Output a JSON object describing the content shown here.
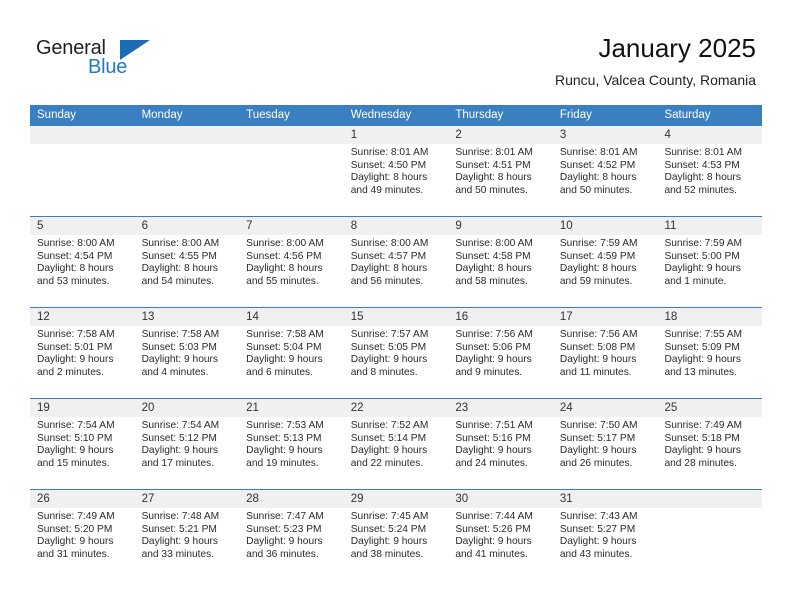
{
  "brand": {
    "name_top": "General",
    "name_bottom": "Blue",
    "accent_color": "#2079c7",
    "triangle_color": "#1b6cb5",
    "triangle_icon": "triangle-icon"
  },
  "header": {
    "title": "January 2025",
    "subtitle": "Runcu, Valcea County, Romania"
  },
  "calendar": {
    "header_bg": "#3a7fc1",
    "band_bg": "#f0f0f0",
    "weekdays": [
      "Sunday",
      "Monday",
      "Tuesday",
      "Wednesday",
      "Thursday",
      "Friday",
      "Saturday"
    ],
    "weeks": [
      [
        {
          "day": "",
          "lines": [
            "",
            "",
            "",
            ""
          ]
        },
        {
          "day": "",
          "lines": [
            "",
            "",
            "",
            ""
          ]
        },
        {
          "day": "",
          "lines": [
            "",
            "",
            "",
            ""
          ]
        },
        {
          "day": "1",
          "lines": [
            "Sunrise: 8:01 AM",
            "Sunset: 4:50 PM",
            "Daylight: 8 hours",
            "and 49 minutes."
          ]
        },
        {
          "day": "2",
          "lines": [
            "Sunrise: 8:01 AM",
            "Sunset: 4:51 PM",
            "Daylight: 8 hours",
            "and 50 minutes."
          ]
        },
        {
          "day": "3",
          "lines": [
            "Sunrise: 8:01 AM",
            "Sunset: 4:52 PM",
            "Daylight: 8 hours",
            "and 50 minutes."
          ]
        },
        {
          "day": "4",
          "lines": [
            "Sunrise: 8:01 AM",
            "Sunset: 4:53 PM",
            "Daylight: 8 hours",
            "and 52 minutes."
          ]
        }
      ],
      [
        {
          "day": "5",
          "lines": [
            "Sunrise: 8:00 AM",
            "Sunset: 4:54 PM",
            "Daylight: 8 hours",
            "and 53 minutes."
          ]
        },
        {
          "day": "6",
          "lines": [
            "Sunrise: 8:00 AM",
            "Sunset: 4:55 PM",
            "Daylight: 8 hours",
            "and 54 minutes."
          ]
        },
        {
          "day": "7",
          "lines": [
            "Sunrise: 8:00 AM",
            "Sunset: 4:56 PM",
            "Daylight: 8 hours",
            "and 55 minutes."
          ]
        },
        {
          "day": "8",
          "lines": [
            "Sunrise: 8:00 AM",
            "Sunset: 4:57 PM",
            "Daylight: 8 hours",
            "and 56 minutes."
          ]
        },
        {
          "day": "9",
          "lines": [
            "Sunrise: 8:00 AM",
            "Sunset: 4:58 PM",
            "Daylight: 8 hours",
            "and 58 minutes."
          ]
        },
        {
          "day": "10",
          "lines": [
            "Sunrise: 7:59 AM",
            "Sunset: 4:59 PM",
            "Daylight: 8 hours",
            "and 59 minutes."
          ]
        },
        {
          "day": "11",
          "lines": [
            "Sunrise: 7:59 AM",
            "Sunset: 5:00 PM",
            "Daylight: 9 hours",
            "and 1 minute."
          ]
        }
      ],
      [
        {
          "day": "12",
          "lines": [
            "Sunrise: 7:58 AM",
            "Sunset: 5:01 PM",
            "Daylight: 9 hours",
            "and 2 minutes."
          ]
        },
        {
          "day": "13",
          "lines": [
            "Sunrise: 7:58 AM",
            "Sunset: 5:03 PM",
            "Daylight: 9 hours",
            "and 4 minutes."
          ]
        },
        {
          "day": "14",
          "lines": [
            "Sunrise: 7:58 AM",
            "Sunset: 5:04 PM",
            "Daylight: 9 hours",
            "and 6 minutes."
          ]
        },
        {
          "day": "15",
          "lines": [
            "Sunrise: 7:57 AM",
            "Sunset: 5:05 PM",
            "Daylight: 9 hours",
            "and 8 minutes."
          ]
        },
        {
          "day": "16",
          "lines": [
            "Sunrise: 7:56 AM",
            "Sunset: 5:06 PM",
            "Daylight: 9 hours",
            "and 9 minutes."
          ]
        },
        {
          "day": "17",
          "lines": [
            "Sunrise: 7:56 AM",
            "Sunset: 5:08 PM",
            "Daylight: 9 hours",
            "and 11 minutes."
          ]
        },
        {
          "day": "18",
          "lines": [
            "Sunrise: 7:55 AM",
            "Sunset: 5:09 PM",
            "Daylight: 9 hours",
            "and 13 minutes."
          ]
        }
      ],
      [
        {
          "day": "19",
          "lines": [
            "Sunrise: 7:54 AM",
            "Sunset: 5:10 PM",
            "Daylight: 9 hours",
            "and 15 minutes."
          ]
        },
        {
          "day": "20",
          "lines": [
            "Sunrise: 7:54 AM",
            "Sunset: 5:12 PM",
            "Daylight: 9 hours",
            "and 17 minutes."
          ]
        },
        {
          "day": "21",
          "lines": [
            "Sunrise: 7:53 AM",
            "Sunset: 5:13 PM",
            "Daylight: 9 hours",
            "and 19 minutes."
          ]
        },
        {
          "day": "22",
          "lines": [
            "Sunrise: 7:52 AM",
            "Sunset: 5:14 PM",
            "Daylight: 9 hours",
            "and 22 minutes."
          ]
        },
        {
          "day": "23",
          "lines": [
            "Sunrise: 7:51 AM",
            "Sunset: 5:16 PM",
            "Daylight: 9 hours",
            "and 24 minutes."
          ]
        },
        {
          "day": "24",
          "lines": [
            "Sunrise: 7:50 AM",
            "Sunset: 5:17 PM",
            "Daylight: 9 hours",
            "and 26 minutes."
          ]
        },
        {
          "day": "25",
          "lines": [
            "Sunrise: 7:49 AM",
            "Sunset: 5:18 PM",
            "Daylight: 9 hours",
            "and 28 minutes."
          ]
        }
      ],
      [
        {
          "day": "26",
          "lines": [
            "Sunrise: 7:49 AM",
            "Sunset: 5:20 PM",
            "Daylight: 9 hours",
            "and 31 minutes."
          ]
        },
        {
          "day": "27",
          "lines": [
            "Sunrise: 7:48 AM",
            "Sunset: 5:21 PM",
            "Daylight: 9 hours",
            "and 33 minutes."
          ]
        },
        {
          "day": "28",
          "lines": [
            "Sunrise: 7:47 AM",
            "Sunset: 5:23 PM",
            "Daylight: 9 hours",
            "and 36 minutes."
          ]
        },
        {
          "day": "29",
          "lines": [
            "Sunrise: 7:45 AM",
            "Sunset: 5:24 PM",
            "Daylight: 9 hours",
            "and 38 minutes."
          ]
        },
        {
          "day": "30",
          "lines": [
            "Sunrise: 7:44 AM",
            "Sunset: 5:26 PM",
            "Daylight: 9 hours",
            "and 41 minutes."
          ]
        },
        {
          "day": "31",
          "lines": [
            "Sunrise: 7:43 AM",
            "Sunset: 5:27 PM",
            "Daylight: 9 hours",
            "and 43 minutes."
          ]
        },
        {
          "day": "",
          "lines": [
            "",
            "",
            "",
            ""
          ]
        }
      ]
    ]
  }
}
